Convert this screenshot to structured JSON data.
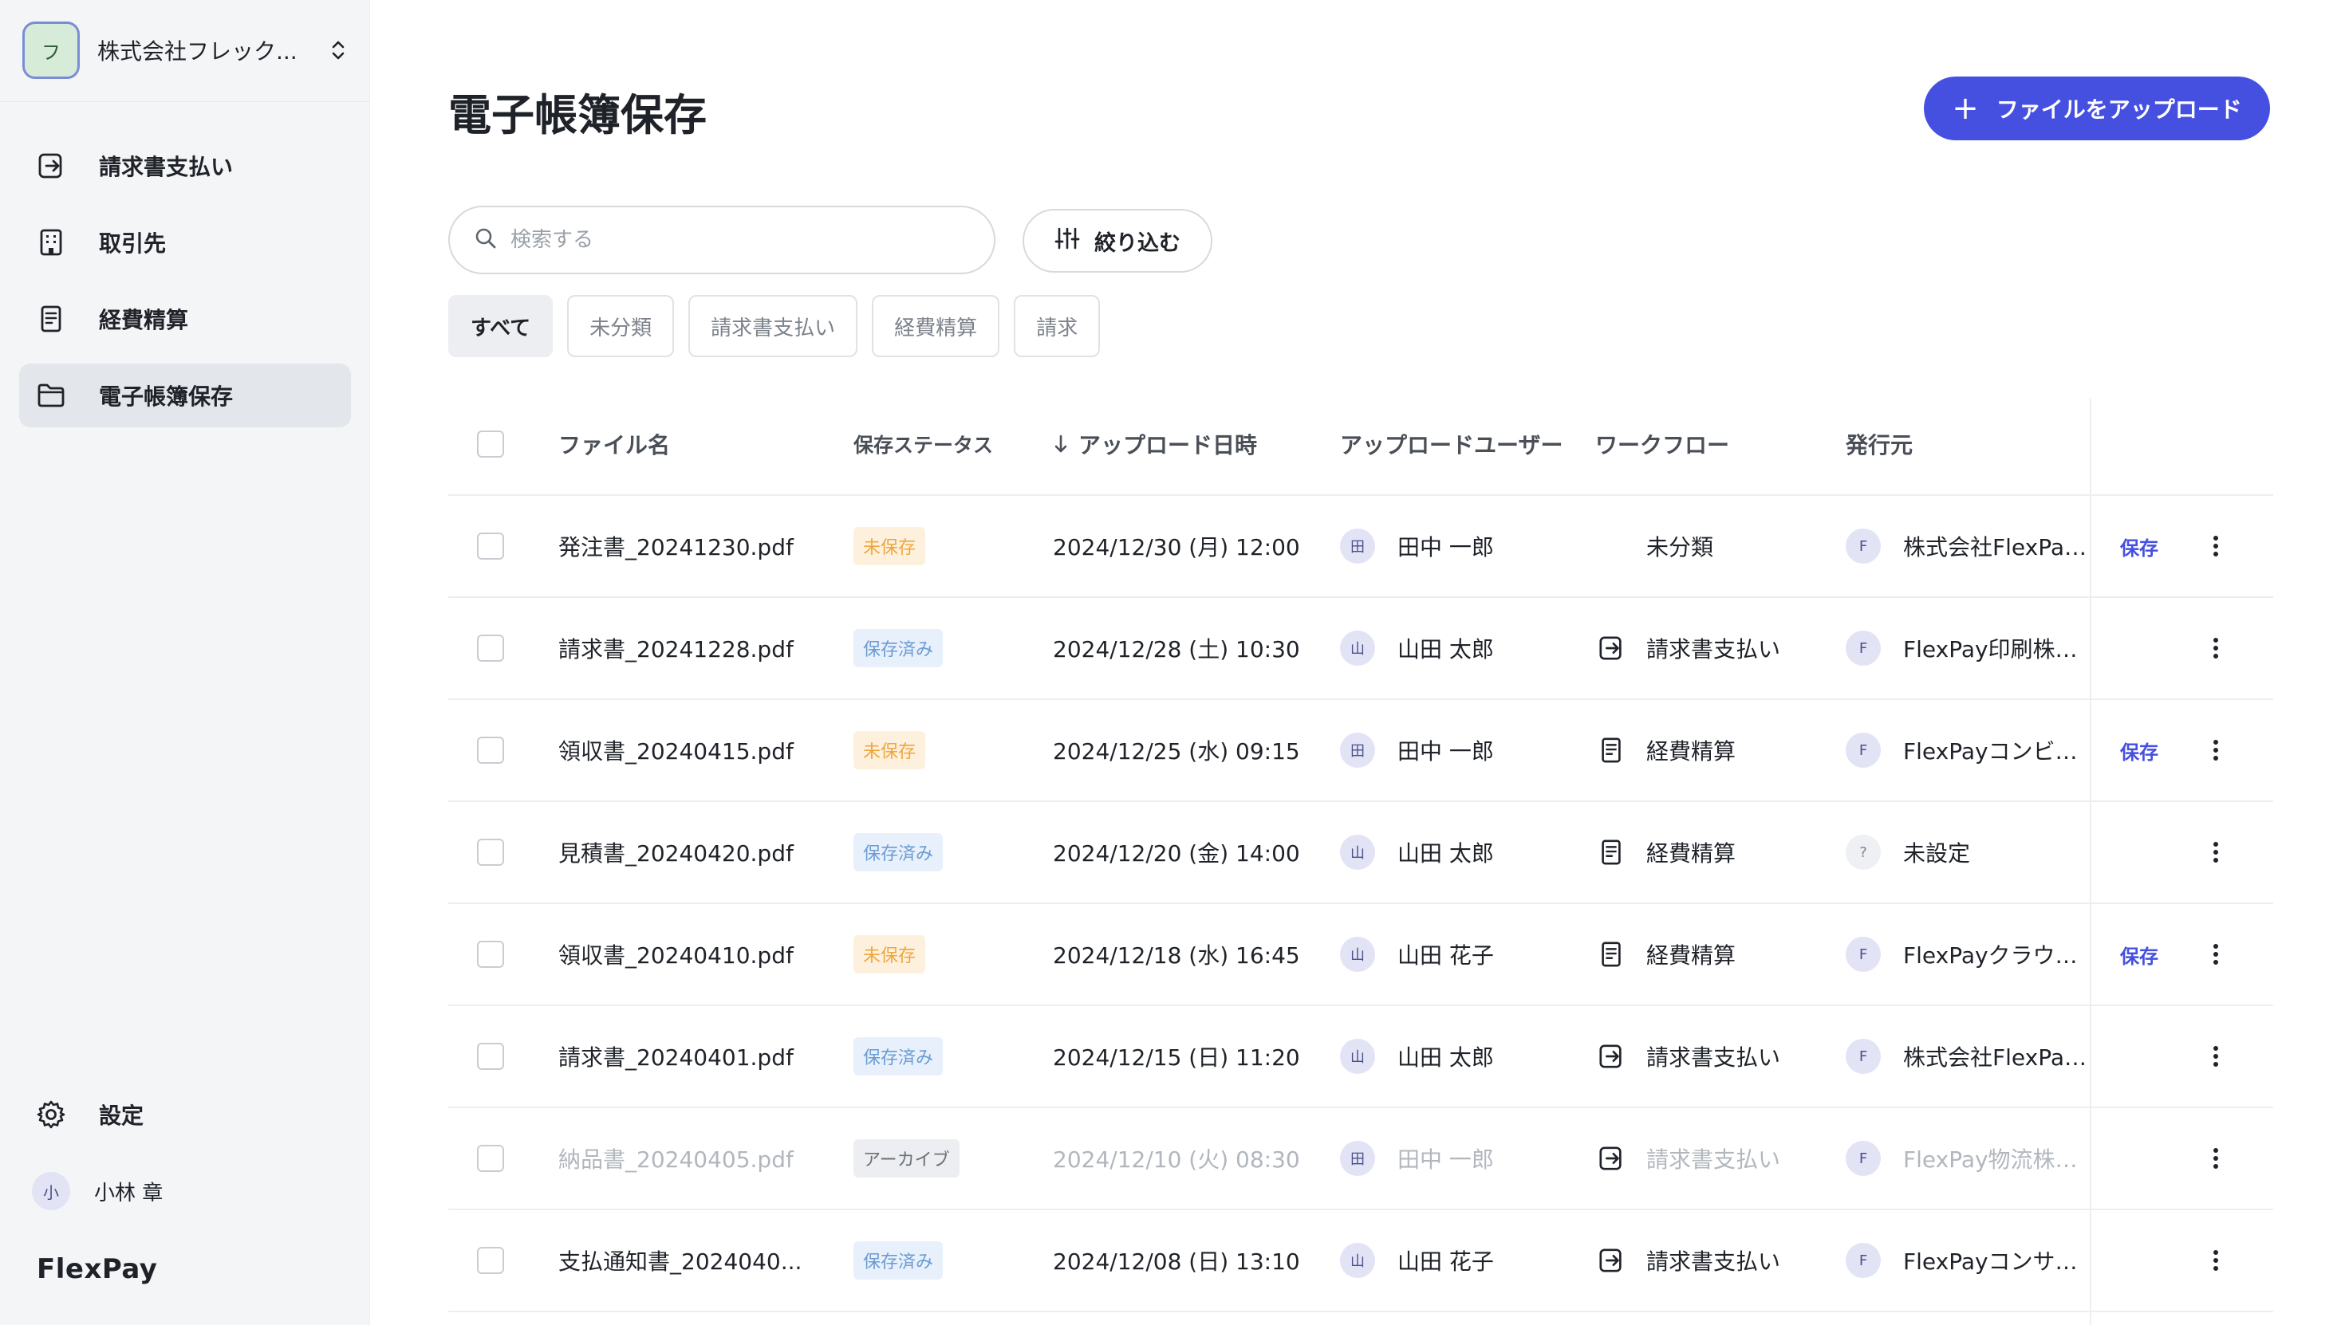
{
  "sidebar": {
    "org": {
      "avatar": "フ",
      "name": "株式会社フレック..."
    },
    "nav": [
      {
        "label": "請求書支払い",
        "icon": "invoice-payment-icon"
      },
      {
        "label": "取引先",
        "icon": "building-icon"
      },
      {
        "label": "経費精算",
        "icon": "receipt-icon"
      },
      {
        "label": "電子帳簿保存",
        "icon": "folder-icon"
      }
    ],
    "settings_label": "設定",
    "user": {
      "avatar": "小",
      "name": "小林 章"
    },
    "brand": "FlexPay"
  },
  "header": {
    "title": "電子帳簿保存",
    "upload_label": "ファイルをアップロード"
  },
  "search": {
    "placeholder": "検索する"
  },
  "filter_label": "絞り込む",
  "chips": [
    "すべて",
    "未分類",
    "請求書支払い",
    "経費精算",
    "請求"
  ],
  "table": {
    "columns": {
      "file": "ファイル名",
      "status": "保存ステータス",
      "date": "アップロード日時",
      "user": "アップロードユーザー",
      "workflow": "ワークフロー",
      "issuer": "発行元"
    },
    "rows": [
      {
        "file": "発注書_20241230.pdf",
        "status": "未保存",
        "status_type": "unsaved",
        "date": "2024/12/30 (月) 12:00",
        "user_avatar": "田",
        "user": "田中 一郎",
        "workflow": "未分類",
        "workflow_icon": "none",
        "issuer_avatar": "F",
        "issuer": "株式会社FlexPay...",
        "action": "保存",
        "archived": false
      },
      {
        "file": "請求書_20241228.pdf",
        "status": "保存済み",
        "status_type": "saved",
        "date": "2024/12/28 (土) 10:30",
        "user_avatar": "山",
        "user": "山田 太郎",
        "workflow": "請求書支払い",
        "workflow_icon": "invoice-payment-icon",
        "issuer_avatar": "F",
        "issuer": "FlexPay印刷株式...",
        "action": "",
        "archived": false
      },
      {
        "file": "領収書_20240415.pdf",
        "status": "未保存",
        "status_type": "unsaved",
        "date": "2024/12/25 (水) 09:15",
        "user_avatar": "田",
        "user": "田中 一郎",
        "workflow": "経費精算",
        "workflow_icon": "receipt-icon",
        "issuer_avatar": "F",
        "issuer": "FlexPayコンビニ...",
        "action": "保存",
        "archived": false
      },
      {
        "file": "見積書_20240420.pdf",
        "status": "保存済み",
        "status_type": "saved",
        "date": "2024/12/20 (金) 14:00",
        "user_avatar": "山",
        "user": "山田 太郎",
        "workflow": "経費精算",
        "workflow_icon": "receipt-icon",
        "issuer_avatar": "?",
        "issuer": "未設定",
        "action": "",
        "archived": false
      },
      {
        "file": "領収書_20240410.pdf",
        "status": "未保存",
        "status_type": "unsaved",
        "date": "2024/12/18 (水) 16:45",
        "user_avatar": "山",
        "user": "山田 花子",
        "workflow": "経費精算",
        "workflow_icon": "receipt-icon",
        "issuer_avatar": "F",
        "issuer": "FlexPayクラウド...",
        "action": "保存",
        "archived": false
      },
      {
        "file": "請求書_20240401.pdf",
        "status": "保存済み",
        "status_type": "saved",
        "date": "2024/12/15 (日) 11:20",
        "user_avatar": "山",
        "user": "山田 太郎",
        "workflow": "請求書支払い",
        "workflow_icon": "invoice-payment-icon",
        "issuer_avatar": "F",
        "issuer": "株式会社FlexPay...",
        "action": "",
        "archived": false
      },
      {
        "file": "納品書_20240405.pdf",
        "status": "アーカイブ",
        "status_type": "archive",
        "date": "2024/12/10 (火) 08:30",
        "user_avatar": "田",
        "user": "田中 一郎",
        "workflow": "請求書支払い",
        "workflow_icon": "invoice-payment-icon",
        "issuer_avatar": "F",
        "issuer": "FlexPay物流株式...",
        "action": "",
        "archived": true
      },
      {
        "file": "支払通知書_2024040...",
        "status": "保存済み",
        "status_type": "saved",
        "date": "2024/12/08 (日) 13:10",
        "user_avatar": "山",
        "user": "山田 花子",
        "workflow": "請求書支払い",
        "workflow_icon": "invoice-payment-icon",
        "issuer_avatar": "F",
        "issuer": "FlexPayコンサル...",
        "action": "",
        "archived": false
      }
    ]
  },
  "colors": {
    "accent": "#4650e0",
    "unsaved_text": "#f0a63c",
    "saved_text": "#6a9bd4"
  }
}
